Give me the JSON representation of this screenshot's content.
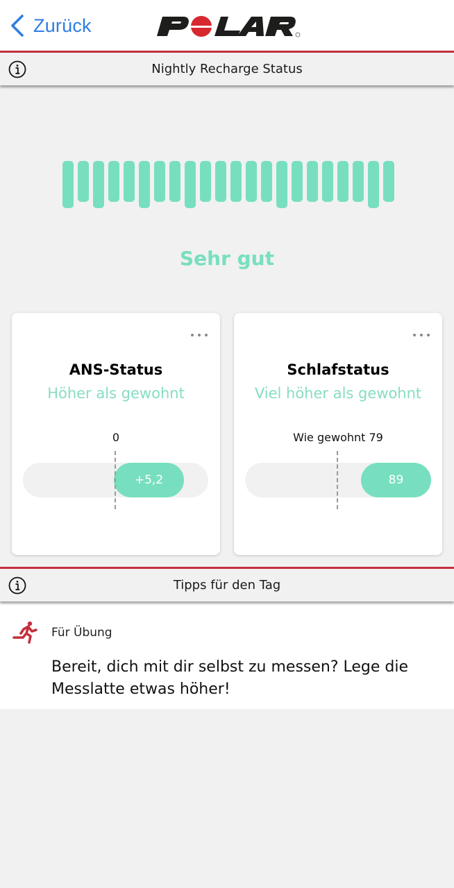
{
  "navbar": {
    "back_label": "Zurück",
    "logo_text": "POLAR",
    "colors": {
      "back": "#2f7de1",
      "logo_dark": "#1d1d1b",
      "logo_red": "#d7282f"
    }
  },
  "sections": {
    "recharge_header": "Nightly Recharge Status",
    "tips_header": "Tipps für den Tag"
  },
  "recharge": {
    "status": "Sehr gut",
    "accent_color": "#77dfbf",
    "bars": [
      {
        "long": true
      },
      {
        "long": false
      },
      {
        "long": true
      },
      {
        "long": false
      },
      {
        "long": false
      },
      {
        "long": true
      },
      {
        "long": false
      },
      {
        "long": false
      },
      {
        "long": true
      },
      {
        "long": false
      },
      {
        "long": false
      },
      {
        "long": false
      },
      {
        "long": false
      },
      {
        "long": false
      },
      {
        "long": true
      },
      {
        "long": false
      },
      {
        "long": false
      },
      {
        "long": false
      },
      {
        "long": false
      },
      {
        "long": false
      },
      {
        "long": true
      },
      {
        "long": false
      }
    ]
  },
  "cards": [
    {
      "title": "ANS-Status",
      "subtitle": "Höher als gewohnt",
      "baseline_label": "0",
      "value_label": "+5,2",
      "baseline": 0,
      "value": 5.2
    },
    {
      "title": "Schlafstatus",
      "subtitle": "Viel höher als gewohnt",
      "baseline_label": "Wie gewohnt 79",
      "value_label": "89",
      "baseline": 79,
      "value": 89
    }
  ],
  "tip": {
    "icon": "running-icon",
    "category": "Für Übung",
    "message": "Bereit, dich mit dir selbst zu messen? Lege die Messlatte etwas höher!",
    "icon_color": "#c3303e"
  }
}
